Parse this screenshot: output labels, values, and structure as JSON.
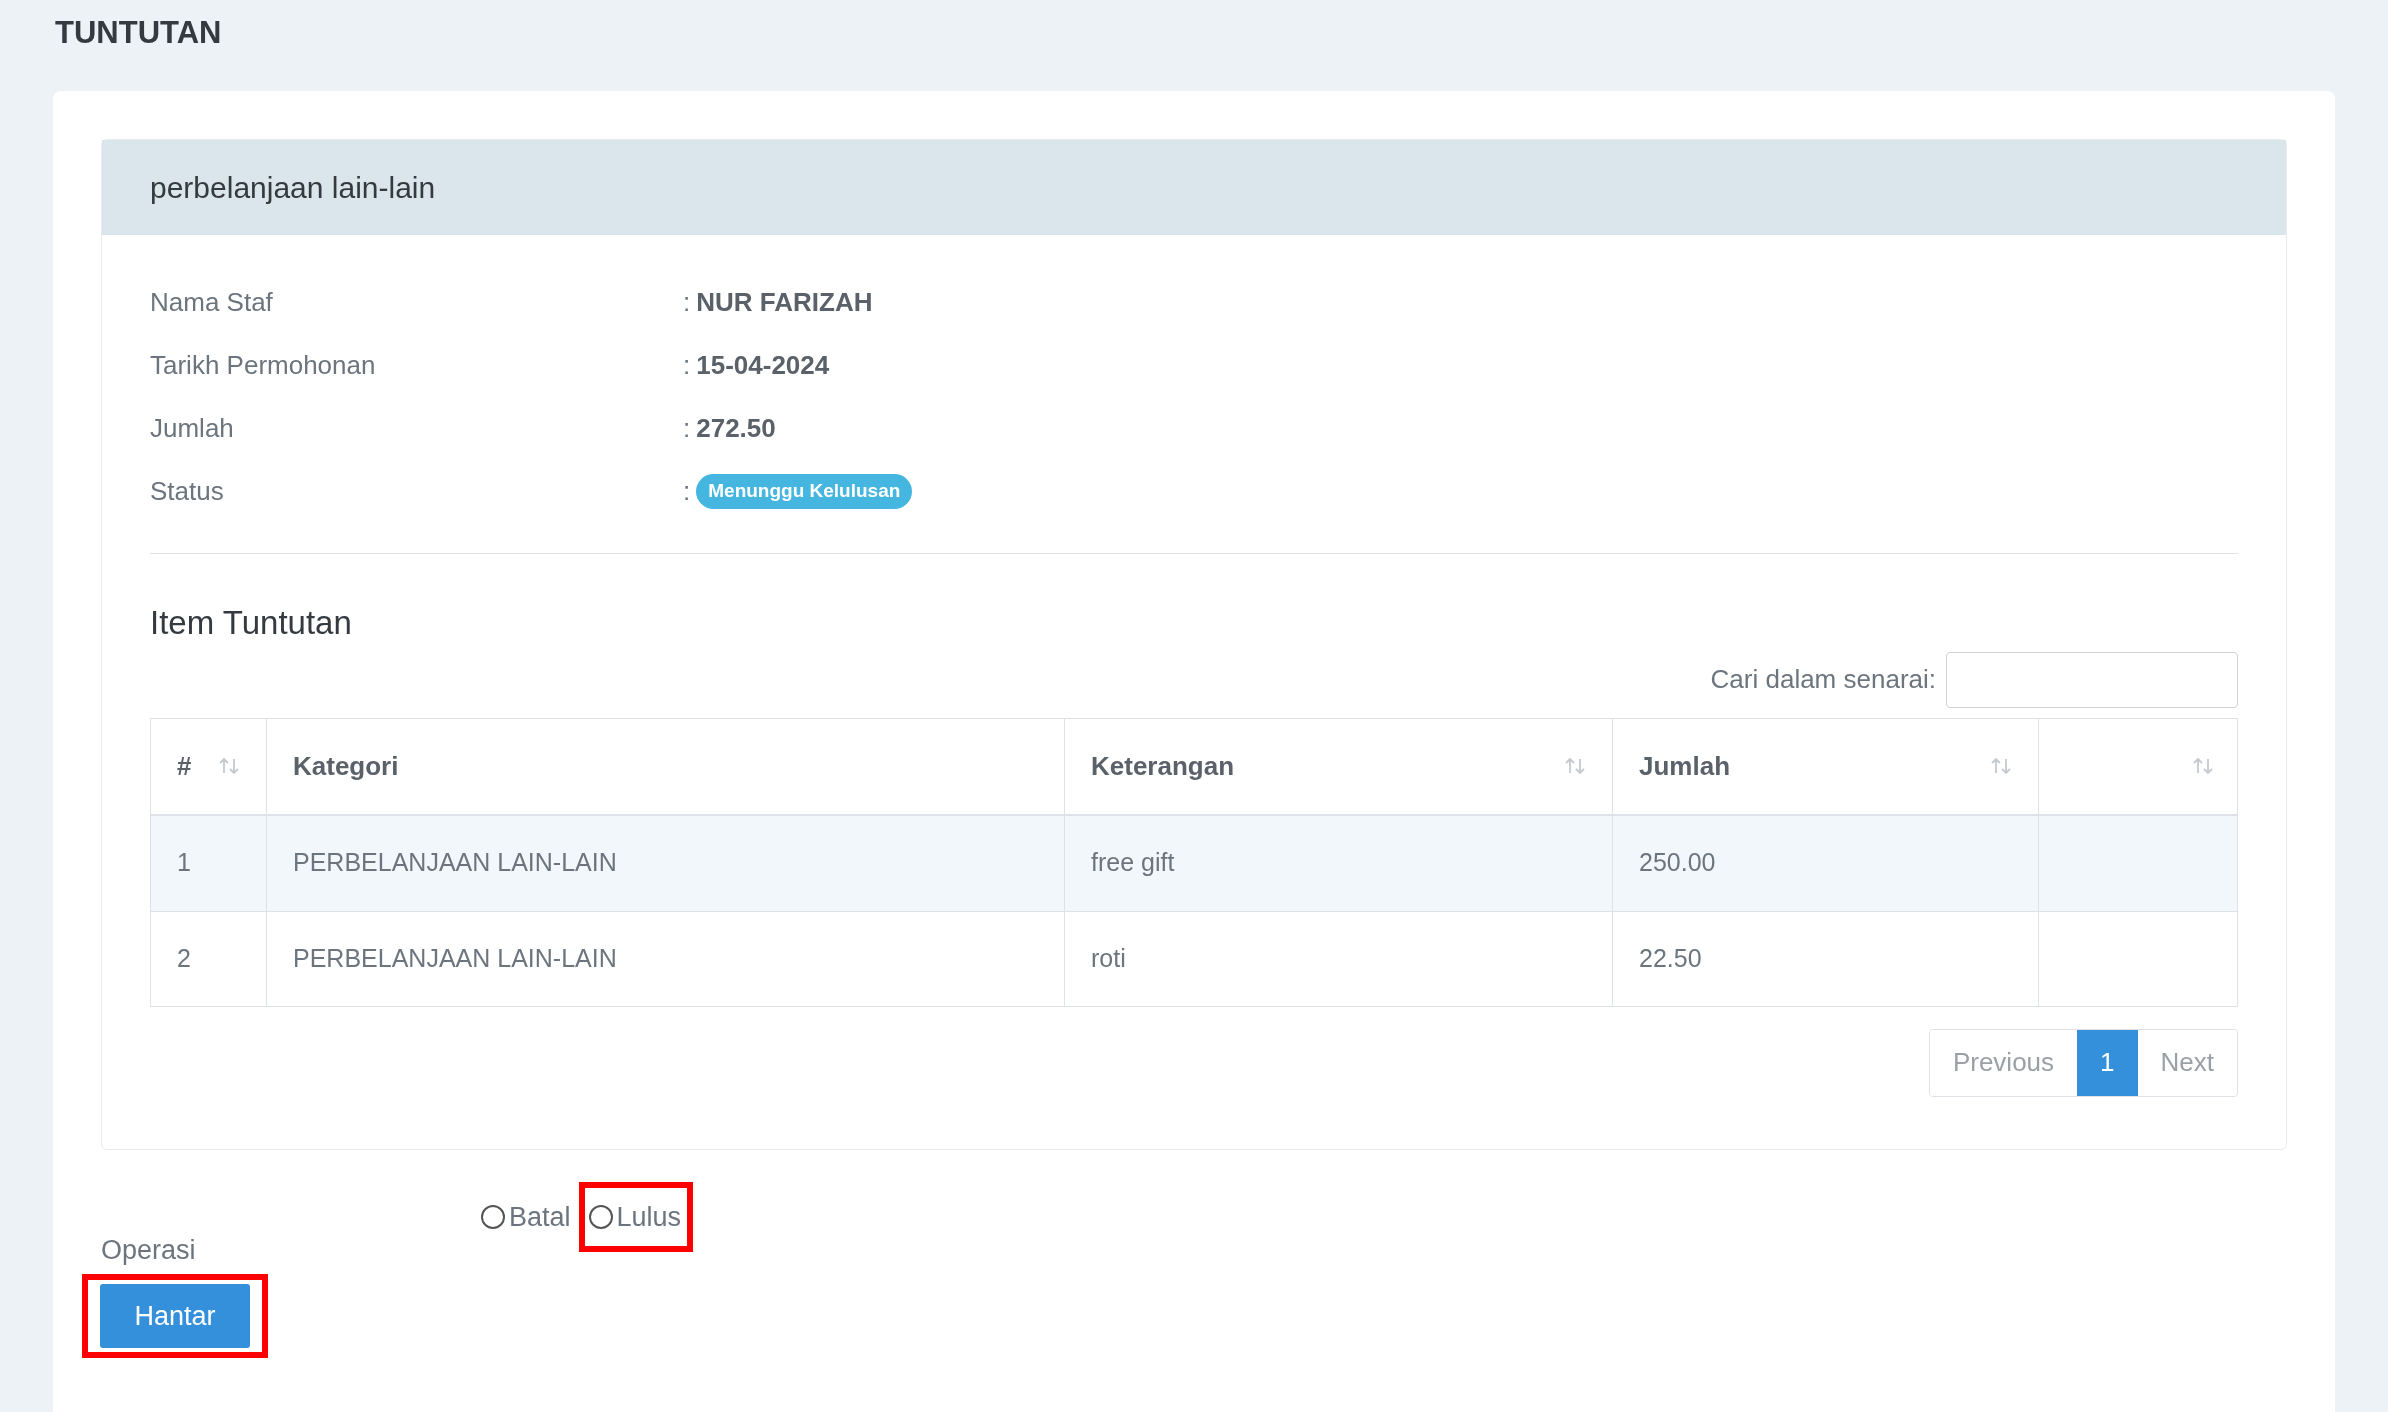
{
  "page_title": "TUNTUTAN",
  "panel": {
    "title": "perbelanjaan lain-lain",
    "details": [
      {
        "label": "Nama Staf",
        "separator": ":",
        "value": "NUR FARIZAH",
        "kind": "text"
      },
      {
        "label": "Tarikh Permohonan",
        "separator": ":",
        "value": "15-04-2024",
        "kind": "text"
      },
      {
        "label": "Jumlah",
        "separator": ":",
        "value": "272.50",
        "kind": "text"
      },
      {
        "label": "Status",
        "separator": ":",
        "value": "Menunggu Kelulusan",
        "kind": "badge"
      }
    ],
    "items_title": "Item Tuntutan",
    "search": {
      "label": "Cari dalam senarai:"
    },
    "table": {
      "columns": [
        "#",
        "Kategori",
        "Keterangan",
        "Jumlah",
        ""
      ],
      "rows": [
        [
          "1",
          "PERBELANJAAN LAIN-LAIN",
          "free gift",
          "250.00",
          ""
        ],
        [
          "2",
          "PERBELANJAAN LAIN-LAIN",
          "roti",
          "22.50",
          ""
        ]
      ]
    },
    "pagination": [
      {
        "label": "Previous",
        "selected": false
      },
      {
        "label": "1",
        "selected": true
      },
      {
        "label": "Next",
        "selected": false
      }
    ]
  },
  "operation": {
    "label": "Operasi",
    "options": [
      {
        "label": "Batal",
        "selected": false,
        "highlighted": false
      },
      {
        "label": "Lulus",
        "selected": false,
        "highlighted": true
      }
    ],
    "submit": {
      "label": "Hantar",
      "highlighted": true
    }
  }
}
